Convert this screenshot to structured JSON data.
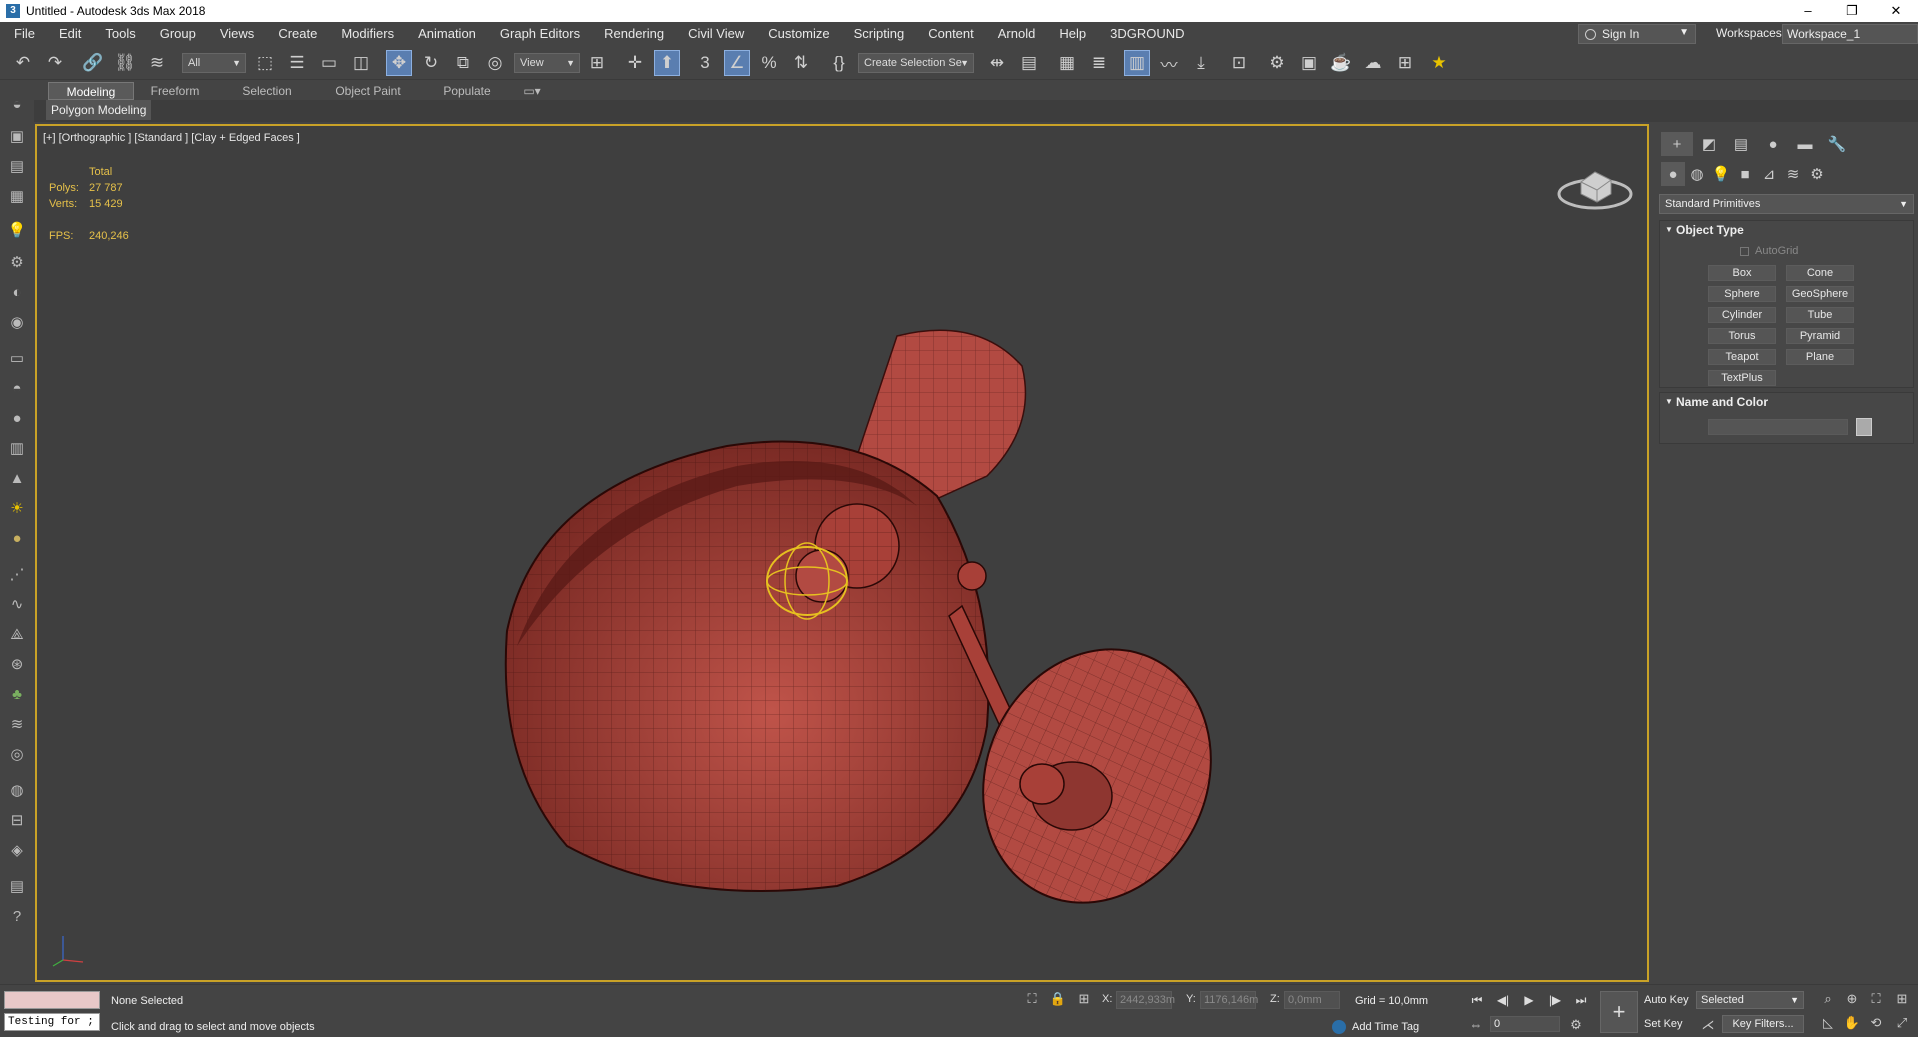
{
  "window": {
    "title": "Untitled - Autodesk 3ds Max 2018",
    "controls": [
      "–",
      "❐",
      "✕"
    ]
  },
  "menu": [
    "File",
    "Edit",
    "Tools",
    "Group",
    "Views",
    "Create",
    "Modifiers",
    "Animation",
    "Graph Editors",
    "Rendering",
    "Civil View",
    "Customize",
    "Scripting",
    "Content",
    "Arnold",
    "Help",
    "3DGROUND"
  ],
  "account": {
    "sign_in": "Sign In",
    "workspaces_label": "Workspaces:",
    "workspace_value": "Workspace_1"
  },
  "toolbar": {
    "filter_value": "All",
    "ref_coord_value": "View",
    "selection_set_value": "Create Selection Se"
  },
  "ribbon": {
    "tabs": [
      "Modeling",
      "Freeform",
      "Selection",
      "Object Paint",
      "Populate"
    ],
    "active_tab": "Modeling",
    "sub_label": "Polygon Modeling"
  },
  "viewport": {
    "label": "[+] [Orthographic ] [Standard ] [Clay + Edged Faces ]",
    "stats": {
      "total_label": "Total",
      "polys_label": "Polys:",
      "polys_value": "27 787",
      "verts_label": "Verts:",
      "verts_value": "15 429",
      "fps_label": "FPS:",
      "fps_value": "240,246"
    },
    "model_color": "#b84a42"
  },
  "command_panel": {
    "category_value": "Standard Primitives",
    "object_type_title": "Object Type",
    "autogrid_label": "AutoGrid",
    "object_buttons": [
      "Box",
      "Cone",
      "Sphere",
      "GeoSphere",
      "Cylinder",
      "Tube",
      "Torus",
      "Pyramid",
      "Teapot",
      "Plane",
      "TextPlus"
    ],
    "name_color_title": "Name and Color"
  },
  "status": {
    "maxscript_text": "Testing for ;",
    "selection_status": "None Selected",
    "prompt": "Click and drag to select and move objects",
    "x_label": "X:",
    "x_value": "2442,933m",
    "y_label": "Y:",
    "y_value": "1176,146m",
    "z_label": "Z:",
    "z_value": "0,0mm",
    "grid": "Grid = 10,0mm",
    "add_time_tag": "Add Time Tag",
    "frame_value": "0",
    "auto_key": "Auto Key",
    "set_key": "Set Key",
    "selected_value": "Selected",
    "key_filters": "Key Filters..."
  }
}
